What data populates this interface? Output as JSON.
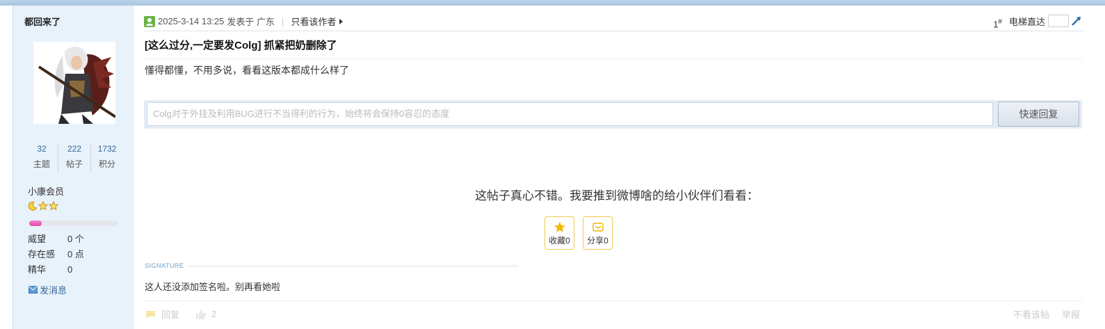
{
  "author": {
    "name": "都回来了",
    "stats": [
      {
        "value": "32",
        "label": "主题"
      },
      {
        "value": "222",
        "label": "帖子"
      },
      {
        "value": "1732",
        "label": "积分"
      }
    ],
    "rank": "小康会员",
    "progress_fraction": 0.14,
    "info": [
      {
        "key": "威望",
        "value": "0 个"
      },
      {
        "key": "存在感",
        "value": "0 点"
      },
      {
        "key": "精华",
        "value": "0"
      }
    ],
    "message_label": "发消息"
  },
  "post": {
    "datetime": "2025-3-14 13:25",
    "posted_in": "发表于 广东",
    "only_author": "只看该作者",
    "floor": "1",
    "floor_mark": "#",
    "jump_label": "电梯直达",
    "title": "[这么过分,一定要发Colg] 抓紧把奶删除了",
    "content": "懂得都懂，不用多说，看看这版本都成什么样了"
  },
  "quick_reply": {
    "placeholder": "Colg对于外挂及利用BUG进行不当得利的行为，始终将会保持0容忍的态度",
    "button": "快速回复"
  },
  "share": {
    "text": "这帖子真心不错。我要推到微博啥的给小伙伴们看看：",
    "favorite_label": "收藏0",
    "share_label": "分享0"
  },
  "signature": {
    "label": "SIGNATURE",
    "text": "这人还没添加签名啦。别再看她啦"
  },
  "footer": {
    "reply": "回复",
    "like_count": "2",
    "hide": "不看该帖",
    "report": "举报"
  },
  "colors": {
    "sidebar_bg": "#e8f2fb",
    "accent_blue": "#336699",
    "progress_pink": "#e04aa9",
    "star_gold": "#f2b705"
  }
}
